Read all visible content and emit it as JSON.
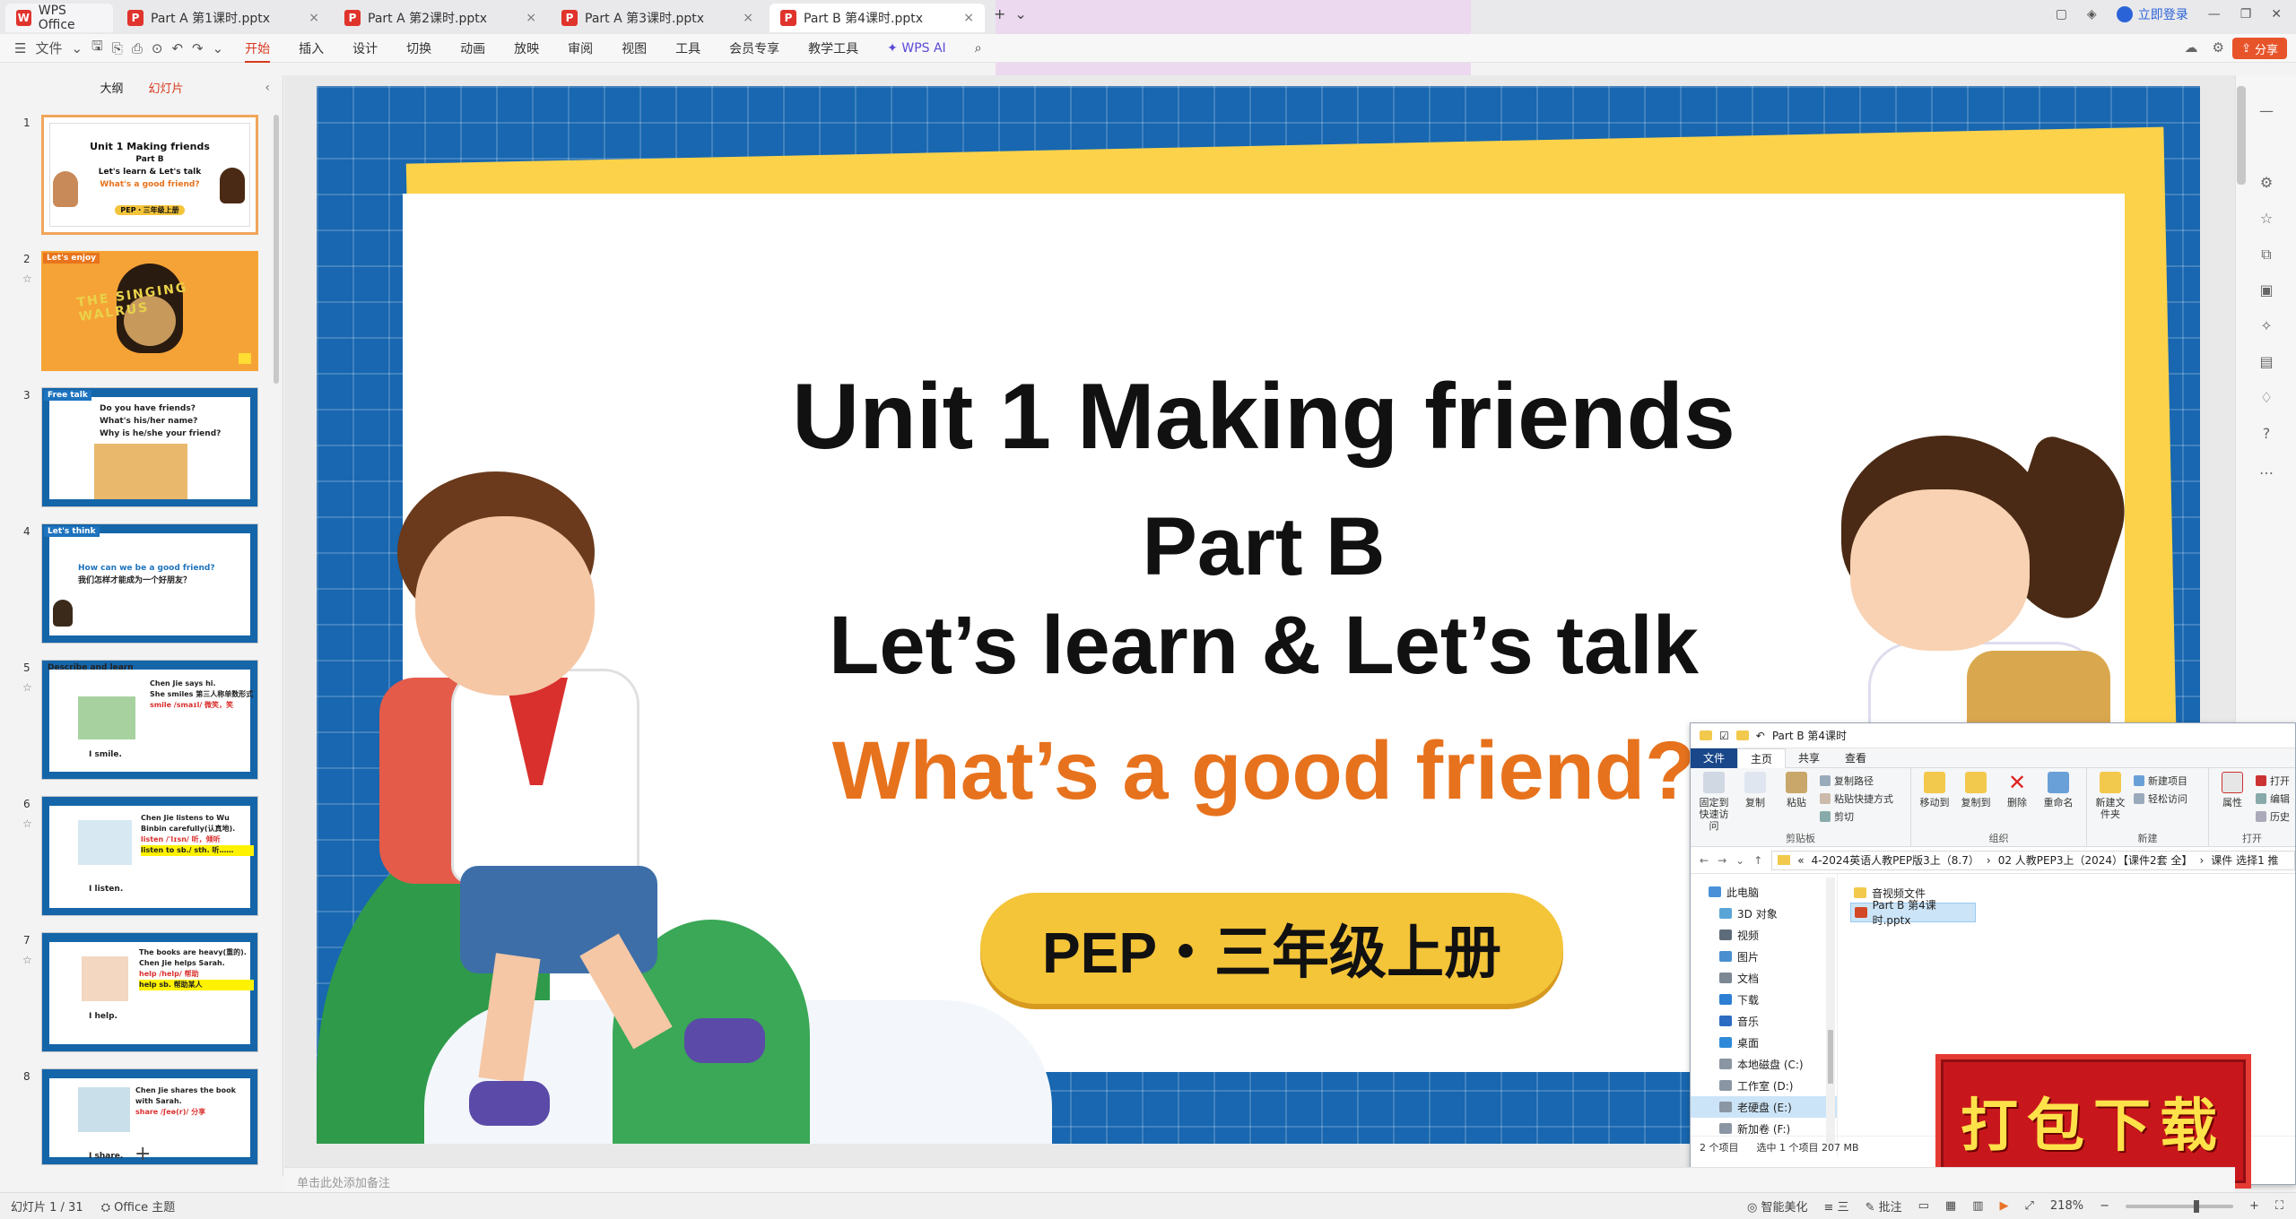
{
  "tabs": [
    {
      "label": "WPS Office",
      "kind": "wps"
    },
    {
      "label": "Part  A 第1课时.pptx",
      "kind": "doc"
    },
    {
      "label": "Part  A 第2课时.pptx",
      "kind": "doc"
    },
    {
      "label": "Part  A 第3课时.pptx",
      "kind": "doc"
    },
    {
      "label": "Part  B 第4课时.pptx",
      "kind": "doc",
      "active": true
    }
  ],
  "titlebar": {
    "login": "立即登录",
    "new_tab": "+"
  },
  "menu": {
    "file": "文件",
    "items": [
      "开始",
      "插入",
      "设计",
      "切换",
      "动画",
      "放映",
      "审阅",
      "视图",
      "工具",
      "会员专享",
      "教学工具"
    ],
    "active": "开始",
    "wps_ai": "WPS AI",
    "share": "分享"
  },
  "panel": {
    "tabs": [
      "大纲",
      "幻灯片"
    ],
    "active_tab": "幻灯片",
    "thumbs": [
      {
        "num": "1",
        "tag": "",
        "lines": [
          "Unit 1 Making friends",
          "Part B",
          "Let's learn & Let's talk",
          "What's a good friend?",
          "PEP・三年级上册"
        ]
      },
      {
        "num": "2",
        "tag": "Let's enjoy",
        "lines": [
          "THE SINGING WALRUS"
        ]
      },
      {
        "num": "3",
        "tag": "Free talk",
        "lines": [
          "Do you have friends?",
          "What's his/her name?",
          "Why is he/she your friend?"
        ]
      },
      {
        "num": "4",
        "tag": "Let's think",
        "lines": [
          "How can we be a good friend?",
          "我们怎样才能成为一个好朋友？"
        ]
      },
      {
        "num": "5",
        "tag": "Describe and learn",
        "lines": [
          "Chen Jie says hi.",
          "She smiles 第三人称单数形式",
          "smile  /smaɪl/  微笑，笑",
          "I smile."
        ]
      },
      {
        "num": "6",
        "tag": "",
        "lines": [
          "Chen Jie listens to Wu Binbin carefully(认真地).",
          "listen  /ˈlɪsn/  听，倾听",
          "listen to sb./ sth.  听……",
          "I listen."
        ]
      },
      {
        "num": "7",
        "tag": "",
        "lines": [
          "The books are heavy(重的).",
          "Chen Jie helps Sarah.",
          "help  /help/  帮助",
          "help sb. 帮助某人",
          "I help."
        ]
      },
      {
        "num": "8",
        "tag": "",
        "lines": [
          "Chen Jie shares the book with Sarah.",
          "share  /ʃeə(r)/  分享",
          "I share."
        ]
      }
    ],
    "add_slide": "+"
  },
  "slide": {
    "title": "Unit 1 Making friends",
    "part": "Part B",
    "subtitle": "Let’s learn & Let’s talk",
    "question": "What’s a good friend?",
    "badge": "PEP・三年级上册"
  },
  "explorer": {
    "title": "Part  B 第4课时",
    "tabs": [
      "文件",
      "主页",
      "共享",
      "查看"
    ],
    "active_tab": "主页",
    "groups": [
      {
        "label": "剪贴板",
        "buttons": [
          "固定到快速访问",
          "复制",
          "粘贴"
        ],
        "small": [
          "复制路径",
          "粘贴快捷方式",
          "剪切"
        ]
      },
      {
        "label": "组织",
        "buttons": [
          "移动到",
          "复制到",
          "删除",
          "重命名"
        ],
        "small": []
      },
      {
        "label": "新建",
        "buttons": [
          "新建文件夹"
        ],
        "small": [
          "新建项目",
          "轻松访问"
        ]
      },
      {
        "label": "打开",
        "buttons": [
          "属性"
        ],
        "small": [
          "打开",
          "编辑",
          "历史"
        ]
      }
    ],
    "address": [
      "4-2024英语人教PEP版3上（8.7）",
      "02 人教PEP3上（2024）【课件2套 全】",
      "课件 选择1 推"
    ],
    "nav": [
      {
        "label": "此电脑",
        "sub": false,
        "color": "#4a90d9"
      },
      {
        "label": "3D 对象",
        "sub": true,
        "color": "#59a5d8"
      },
      {
        "label": "视频",
        "sub": true,
        "color": "#5e6b7a"
      },
      {
        "label": "图片",
        "sub": true,
        "color": "#4a8fcf"
      },
      {
        "label": "文档",
        "sub": true,
        "color": "#7c8794"
      },
      {
        "label": "下载",
        "sub": true,
        "color": "#2d7fd3"
      },
      {
        "label": "音乐",
        "sub": true,
        "color": "#2d6cc0"
      },
      {
        "label": "桌面",
        "sub": true,
        "color": "#2e8ad8"
      },
      {
        "label": "本地磁盘 (C:)",
        "sub": true,
        "color": "#8a96a3"
      },
      {
        "label": "工作室 (D:)",
        "sub": true,
        "color": "#8a96a3"
      },
      {
        "label": "老硬盘 (E:)",
        "sub": true,
        "color": "#8a96a3",
        "selected": true
      },
      {
        "label": "新加卷 (F:)",
        "sub": true,
        "color": "#8a96a3"
      }
    ],
    "files": [
      {
        "name": "音视频文件",
        "type": "folder"
      },
      {
        "name": "Part  B 第4课时.pptx",
        "type": "pptx",
        "selected": true
      }
    ],
    "status": {
      "count": "2 个项目",
      "selected": "选中 1 个项目  207 MB"
    }
  },
  "stamp": {
    "text": "打包下载"
  },
  "notes": {
    "placeholder": "单击此处添加备注"
  },
  "status": {
    "slide": "幻灯片 1 / 31",
    "theme": "Office 主题",
    "beautify": "智能美化",
    "align": "三",
    "comment": "批注",
    "zoom": "218%"
  }
}
